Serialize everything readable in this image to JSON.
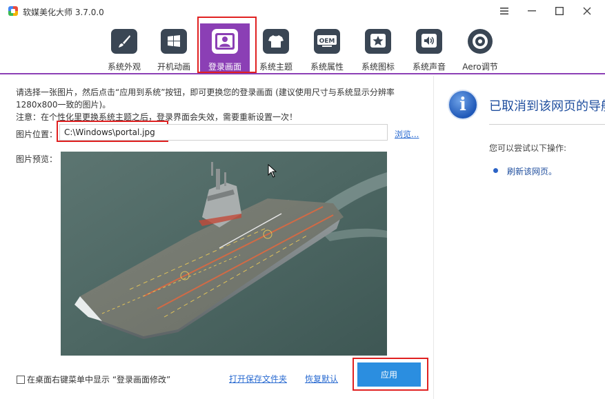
{
  "window": {
    "title": "软媒美化大师 3.7.0.0",
    "menu_icon": "hamburger-menu-icon",
    "minimize_icon": "minimize-icon",
    "maximize_icon": "maximize-icon",
    "close_icon": "close-icon"
  },
  "toolbar": {
    "items": [
      {
        "label": "系统外观",
        "icon": "brush-icon",
        "active": false
      },
      {
        "label": "开机动画",
        "icon": "windows-logo-icon",
        "active": false
      },
      {
        "label": "登录画面",
        "icon": "user-portrait-icon",
        "active": true
      },
      {
        "label": "系统主题",
        "icon": "tshirt-icon",
        "active": false
      },
      {
        "label": "系统属性",
        "icon": "oem-icon",
        "active": false
      },
      {
        "label": "系统图标",
        "icon": "star-icon",
        "active": false
      },
      {
        "label": "系统声音",
        "icon": "speaker-icon",
        "active": false
      },
      {
        "label": "Aero调节",
        "icon": "aero-target-icon",
        "active": false
      }
    ],
    "oem_text": "OEM"
  },
  "main": {
    "description_line1": "请选择一张图片，然后点击“应用到系统”按钮，即可更换您的登录画面 (建议使用尺寸与系统显示分辨率",
    "description_line2": "1280x800一致的图片)。",
    "notice": "注意：在个性化里更换系统主题之后，登录界面会失效，需要重新设置一次！",
    "path_label": "图片位置：",
    "path_value": "C:\\Windows\\portal.jpg",
    "browse_label": "浏览...",
    "preview_label": "图片预览：",
    "preview_image": "aircraft-carrier-photo"
  },
  "footer": {
    "checkbox_label": "在桌面右键菜单中显示 “登录画面修改”",
    "checkbox_checked": false,
    "open_folder_label": "打开保存文件夹",
    "restore_default_label": "恢复默认",
    "apply_label": "应用"
  },
  "right_panel": {
    "title": "已取消到该网页的导航",
    "subtitle": "您可以尝试以下操作:",
    "refresh_link": "刷新该网页。"
  },
  "colors": {
    "accent": "#8b3fb5",
    "icon_tile": "#3a4654",
    "link": "#2a6bd1",
    "apply_button": "#2b8ee0",
    "highlight": "#e02020",
    "info_title": "#1f4e9e"
  }
}
